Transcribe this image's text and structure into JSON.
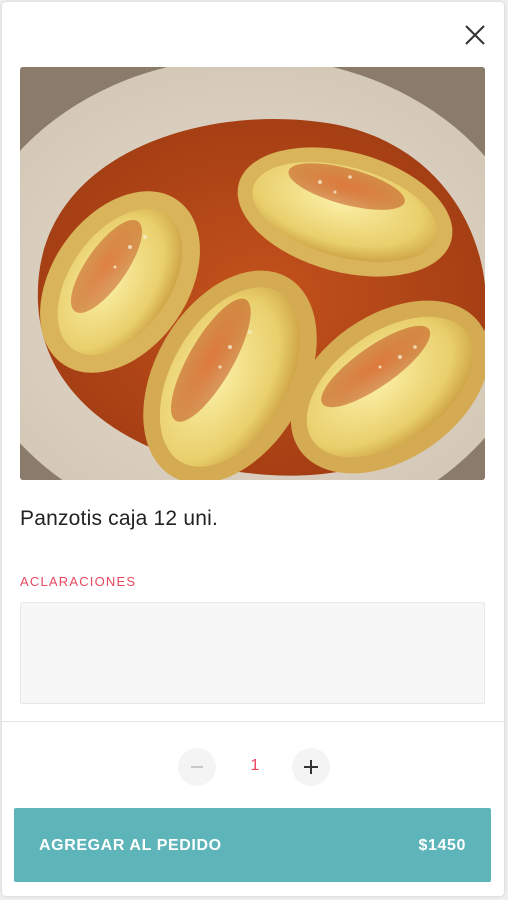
{
  "colors": {
    "accent": "#5db4b9",
    "label_red": "#e8475e",
    "title_text": "#222222"
  },
  "modal": {
    "close_icon": "close-icon",
    "image_icon": "product-photo"
  },
  "product": {
    "name": "Panzotis caja 12 uni."
  },
  "notes": {
    "label": "ACLARACIONES",
    "value": "",
    "placeholder": ""
  },
  "quantity": {
    "value": "1",
    "minus_icon": "minus-icon",
    "plus_icon": "plus-icon"
  },
  "add_button": {
    "label": "AGREGAR AL PEDIDO",
    "price": "$1450"
  }
}
